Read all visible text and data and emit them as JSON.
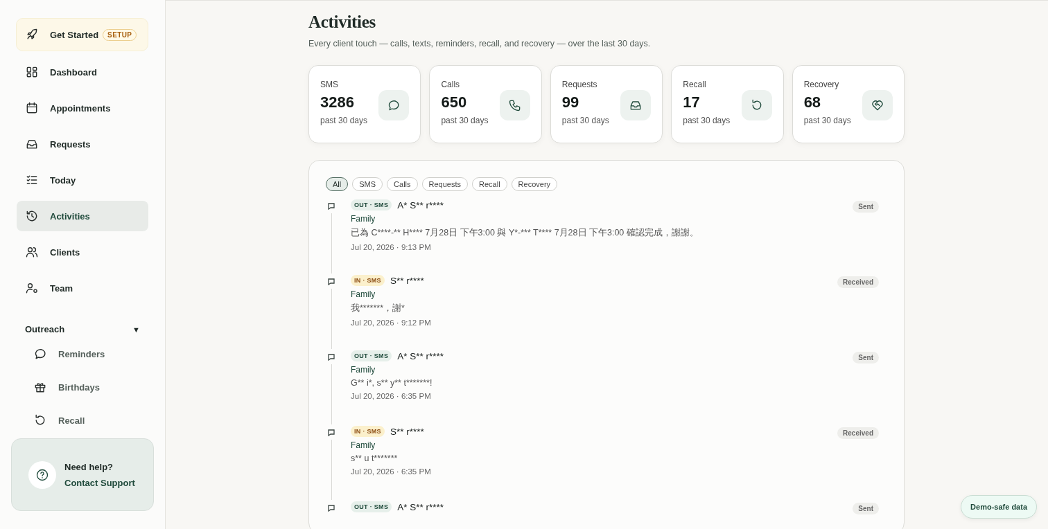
{
  "sidebar": {
    "get_started": {
      "label": "Get Started",
      "badge": "SETUP"
    },
    "items": [
      {
        "label": "Dashboard",
        "selected": false
      },
      {
        "label": "Appointments",
        "selected": false
      },
      {
        "label": "Requests",
        "selected": false
      },
      {
        "label": "Today",
        "selected": false
      },
      {
        "label": "Activities",
        "selected": true
      },
      {
        "label": "Clients",
        "selected": false
      },
      {
        "label": "Team",
        "selected": false
      }
    ],
    "outreach": {
      "label": "Outreach",
      "toggle": "▼",
      "expanded": true,
      "items": [
        {
          "label": "Reminders"
        },
        {
          "label": "Birthdays"
        },
        {
          "label": "Recall"
        }
      ]
    },
    "help": {
      "title": "Need help?",
      "link": "Contact Support"
    }
  },
  "page": {
    "title": "Activities",
    "subtitle": "Every client touch — calls, texts, reminders, recall, and recovery — over the last 30 days."
  },
  "stats": [
    {
      "label": "SMS",
      "value": "3286",
      "period": "past 30 days"
    },
    {
      "label": "Calls",
      "value": "650",
      "period": "past 30 days"
    },
    {
      "label": "Requests",
      "value": "99",
      "period": "past 30 days"
    },
    {
      "label": "Recall",
      "value": "17",
      "period": "past 30 days"
    },
    {
      "label": "Recovery",
      "value": "68",
      "period": "past 30 days"
    }
  ],
  "filters": [
    {
      "label": "All",
      "selected": true
    },
    {
      "label": "SMS",
      "selected": false
    },
    {
      "label": "Calls",
      "selected": false
    },
    {
      "label": "Requests",
      "selected": false
    },
    {
      "label": "Recall",
      "selected": false
    },
    {
      "label": "Recovery",
      "selected": false
    }
  ],
  "activities": [
    {
      "kind": "out",
      "tag": "OUT · SMS",
      "name": "A* S** r****",
      "group": "Family",
      "message": "已為 C****-** H**** 7月28日 下午3:00 與 Y*-*** T**** 7月28日 下午3:00 確認完成，謝謝。",
      "time": "Jul 20, 2026 · 9:13 PM",
      "status": "Sent"
    },
    {
      "kind": "in",
      "tag": "IN · SMS",
      "name": "S** r****",
      "group": "Family",
      "message": "我*******，謝*",
      "time": "Jul 20, 2026 · 9:12 PM",
      "status": "Received"
    },
    {
      "kind": "out",
      "tag": "OUT · SMS",
      "name": "A* S** r****",
      "group": "Family",
      "message": "G** i*, s** y** t*******!",
      "time": "Jul 20, 2026 · 6:35 PM",
      "status": "Sent"
    },
    {
      "kind": "in",
      "tag": "IN · SMS",
      "name": "S** r****",
      "group": "Family",
      "message": "s** u t*******",
      "time": "Jul 20, 2026 · 6:35 PM",
      "status": "Received"
    },
    {
      "kind": "out",
      "tag": "OUT · SMS",
      "name": "A* S** r****",
      "status": "Sent"
    }
  ],
  "demo_badge": "Demo-safe data"
}
